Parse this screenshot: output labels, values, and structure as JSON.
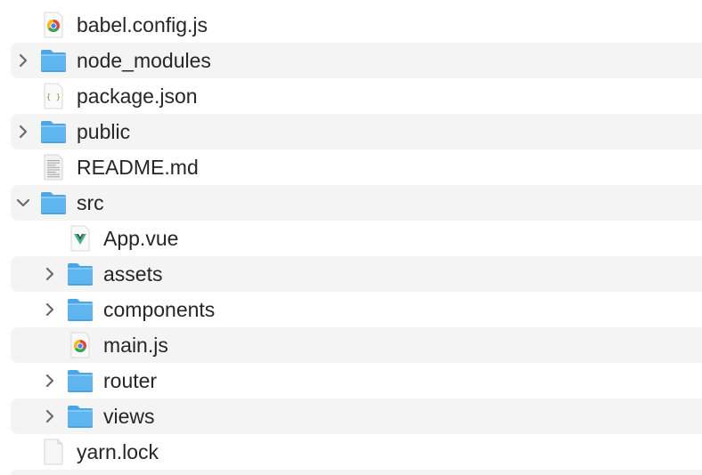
{
  "files": [
    {
      "name": "babel.config.js",
      "icon": "chrome-js-file-icon",
      "kind": "file",
      "depth": 0
    },
    {
      "name": "node_modules",
      "icon": "folder-icon",
      "kind": "folder",
      "expanded": false,
      "depth": 0
    },
    {
      "name": "package.json",
      "icon": "json-file-icon",
      "kind": "file",
      "depth": 0
    },
    {
      "name": "public",
      "icon": "folder-icon",
      "kind": "folder",
      "expanded": false,
      "depth": 0
    },
    {
      "name": "README.md",
      "icon": "text-document-icon",
      "kind": "file",
      "depth": 0
    },
    {
      "name": "src",
      "icon": "folder-icon",
      "kind": "folder",
      "expanded": true,
      "depth": 0
    },
    {
      "name": "App.vue",
      "icon": "vue-file-icon",
      "kind": "file",
      "depth": 1
    },
    {
      "name": "assets",
      "icon": "folder-icon",
      "kind": "folder",
      "expanded": false,
      "depth": 1
    },
    {
      "name": "components",
      "icon": "folder-icon",
      "kind": "folder",
      "expanded": false,
      "depth": 1
    },
    {
      "name": "main.js",
      "icon": "chrome-js-file-icon",
      "kind": "file",
      "depth": 1
    },
    {
      "name": "router",
      "icon": "folder-icon",
      "kind": "folder",
      "expanded": false,
      "depth": 1
    },
    {
      "name": "views",
      "icon": "folder-icon",
      "kind": "folder",
      "expanded": false,
      "depth": 1
    },
    {
      "name": "yarn.lock",
      "icon": "blank-document-icon",
      "kind": "file",
      "depth": 0
    }
  ],
  "colors": {
    "folder": "#5fb5ee",
    "folder_tab": "#4aa6e6",
    "alt_row": "#f4f4f5",
    "text": "#262626",
    "chevron": "#6b6b6b",
    "vue_green": "#41b883",
    "vue_dark": "#35495e"
  }
}
